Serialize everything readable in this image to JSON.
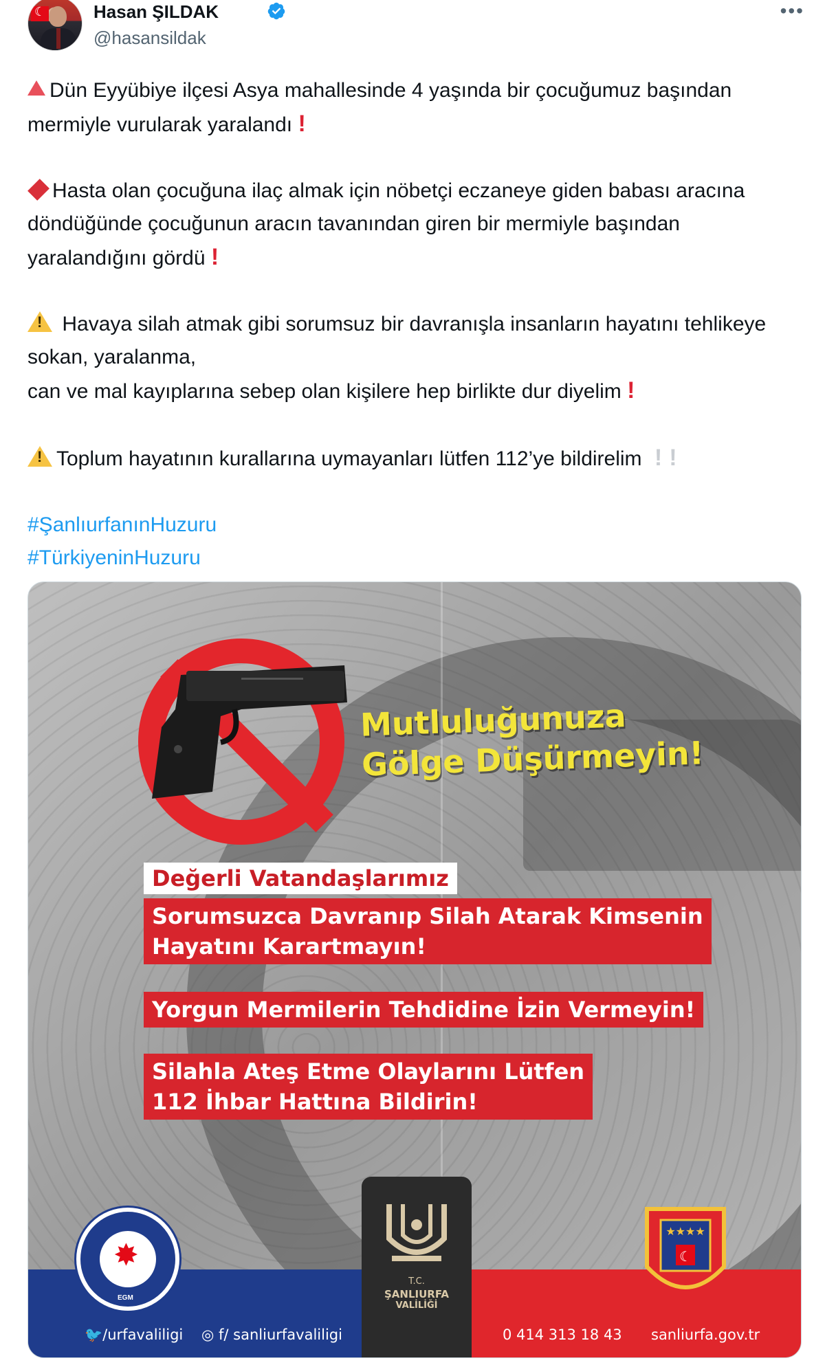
{
  "author": {
    "display_name": "Hasan ŞILDAK",
    "handle": "@hasansildak",
    "verified": true
  },
  "more_menu": "•••",
  "tweet": {
    "p1": "Dün Eyyübiye ilçesi Asya mahallesinde 4 yaşında bir çocuğumuz başından mermiyle vurularak yaralandı",
    "p2": "Hasta olan çocuğuna ilaç almak için nöbetçi eczaneye giden babası aracına döndüğünde çocuğunun aracın tavanından giren bir mermiyle başından yaralandığını gördü",
    "p3_line1": "Havaya silah atmak gibi sorumsuz bir davranışla insanların hayatını tehlikeye sokan, yaralanma,",
    "p3_line2": "can ve mal kayıplarına sebep olan kişilere hep birlikte dur diyelim",
    "p4": "Toplum hayatının kurallarına uymayanları lütfen 112’ye bildirelim",
    "hashtag1": "#ŞanlıurfanınHuzuru",
    "hashtag2": "#TürkiyeninHuzuru",
    "exclaim": "!"
  },
  "poster": {
    "slogan_line1": "Mutluluğunuza",
    "slogan_line2": "Gölge Düşürmeyin!",
    "banner_white": "Değerli Vatandaşlarımız",
    "banner1_line1": "Sorumsuzca Davranıp Silah Atarak Kimsenin",
    "banner1_line2": "Hayatını Karartmayın!",
    "banner2": "Yorgun Mermilerin Tehdidine İzin Vermeyin!",
    "banner3_line1": "Silahla Ateş Etme Olaylarını Lütfen",
    "banner3_line2": "112 İhbar Hattına Bildirin!",
    "egm_label": "EGM",
    "valilik_tc": "T.C.",
    "valilik_name": "ŞANLIURFA",
    "valilik_sub": "VALİLİĞİ",
    "footer_twitter": "/urfavaliligi",
    "footer_social": "/ sanliurfavaliligi",
    "footer_phone": "0 414 313 18 43",
    "footer_web": "sanliurfa.gov.tr",
    "colors": {
      "red": "#d7252d",
      "blue": "#1f3c8c",
      "yellow": "#f3e53a"
    }
  },
  "colors": {
    "link": "#1d9bf0",
    "text": "#0f1419",
    "muted": "#536471"
  },
  "icons": [
    "verified-badge-icon",
    "more-icon",
    "warning-icon",
    "red-triangle-icon",
    "red-diamond-icon",
    "no-gun-icon",
    "twitter-icon",
    "instagram-icon",
    "facebook-icon"
  ]
}
